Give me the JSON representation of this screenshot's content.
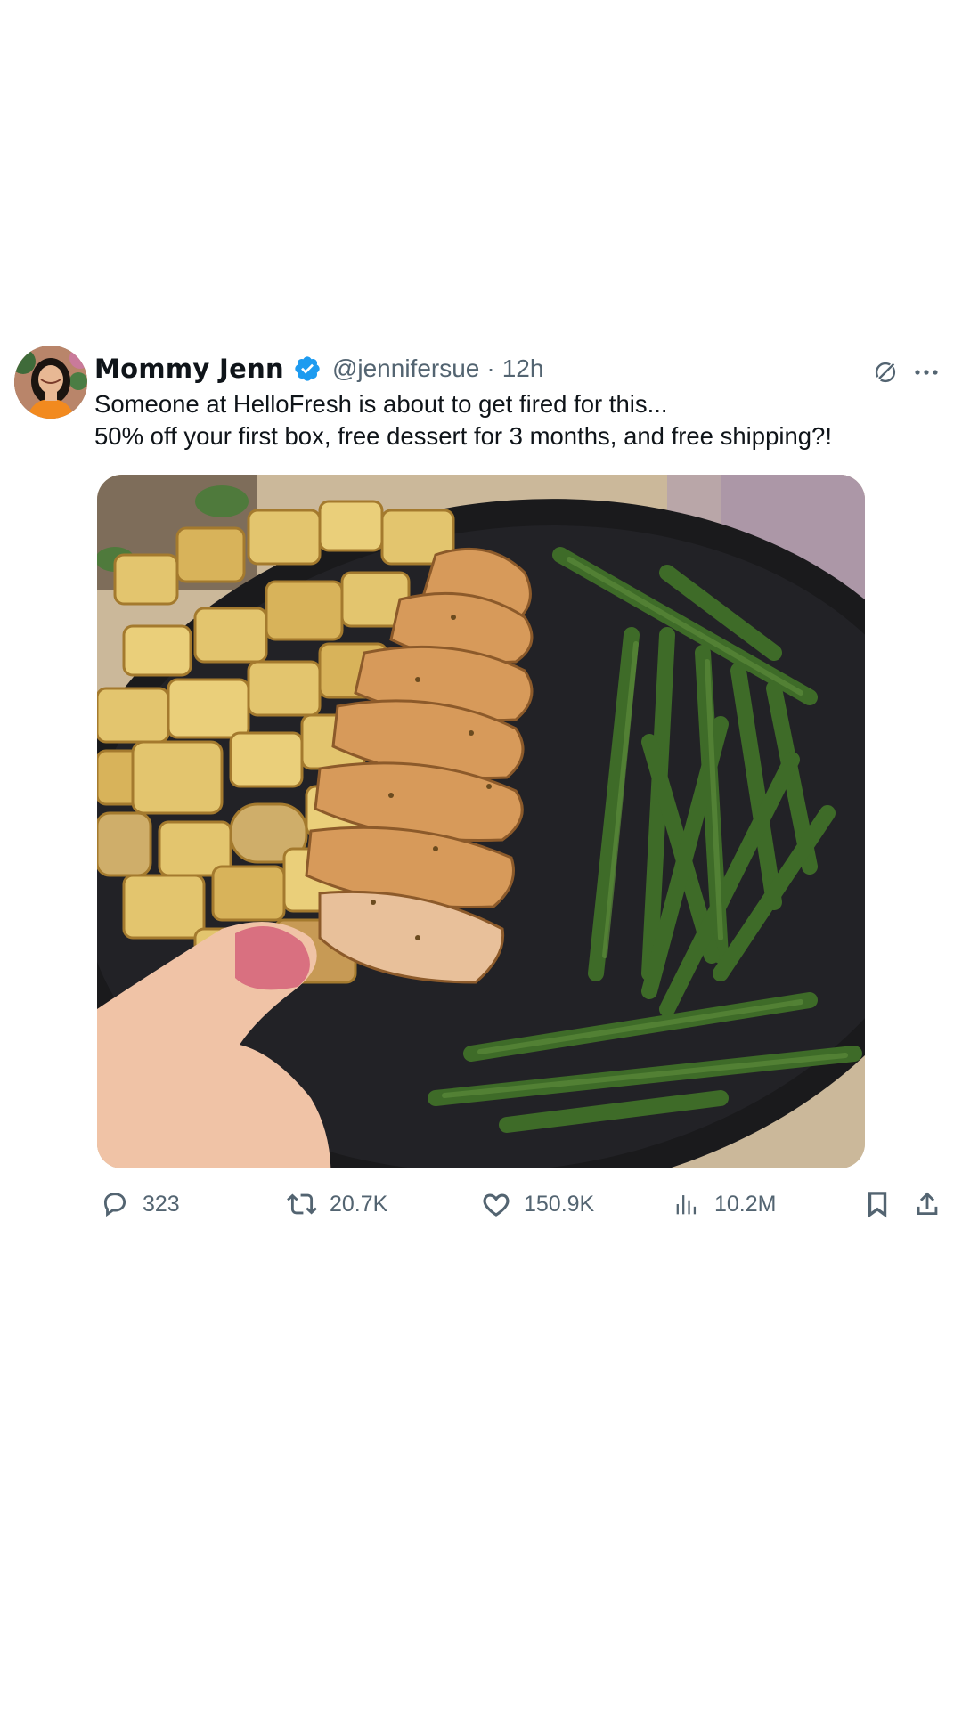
{
  "post": {
    "author": {
      "display_name": "Mommy Jenn",
      "handle": "@jennifersue",
      "verified": true,
      "verified_color": "#1d9bf0",
      "avatar_icon": "avatar-photo"
    },
    "separator": "·",
    "timestamp": "12h",
    "text_lines": [
      "Someone at HelloFresh is about to get fired for this...",
      "50% off your first box, free dessert for 3 months, and free shipping?!"
    ],
    "media": {
      "kind": "photo",
      "subject_icon": "food-plate-image"
    },
    "header_icons": [
      "grok-icon",
      "more-icon"
    ],
    "actions": {
      "replies": "323",
      "reposts": "20.7K",
      "likes": "150.9K",
      "views": "10.2M"
    },
    "colors": {
      "text_primary": "#0f1419",
      "text_secondary": "#536471"
    }
  }
}
